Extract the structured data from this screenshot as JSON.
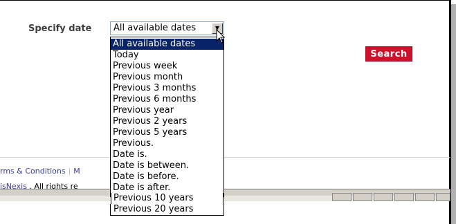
{
  "filter": {
    "label": "Specify date",
    "selected_value": "All available dates",
    "options": [
      "All available dates",
      "Today",
      "Previous week",
      "Previous month",
      "Previous 3 months",
      "Previous 6 months",
      "Previous year",
      "Previous 2 years",
      "Previous 5 years",
      "Previous.",
      "Date is.",
      "Date is between.",
      "Date is before.",
      "Date is after.",
      "Previous 10 years",
      "Previous 20 years"
    ],
    "highlighted_index": 0
  },
  "search_button": {
    "label": "Search"
  },
  "footer": {
    "link_terms": "rms & Conditions",
    "link_next": "M",
    "copyright_brand": "isNexis",
    "copyright_rest": ". All rights re"
  },
  "colors": {
    "selection_bg": "#0a246a",
    "search_button_bg": "#d0102a",
    "link": "#3b3b9b"
  }
}
